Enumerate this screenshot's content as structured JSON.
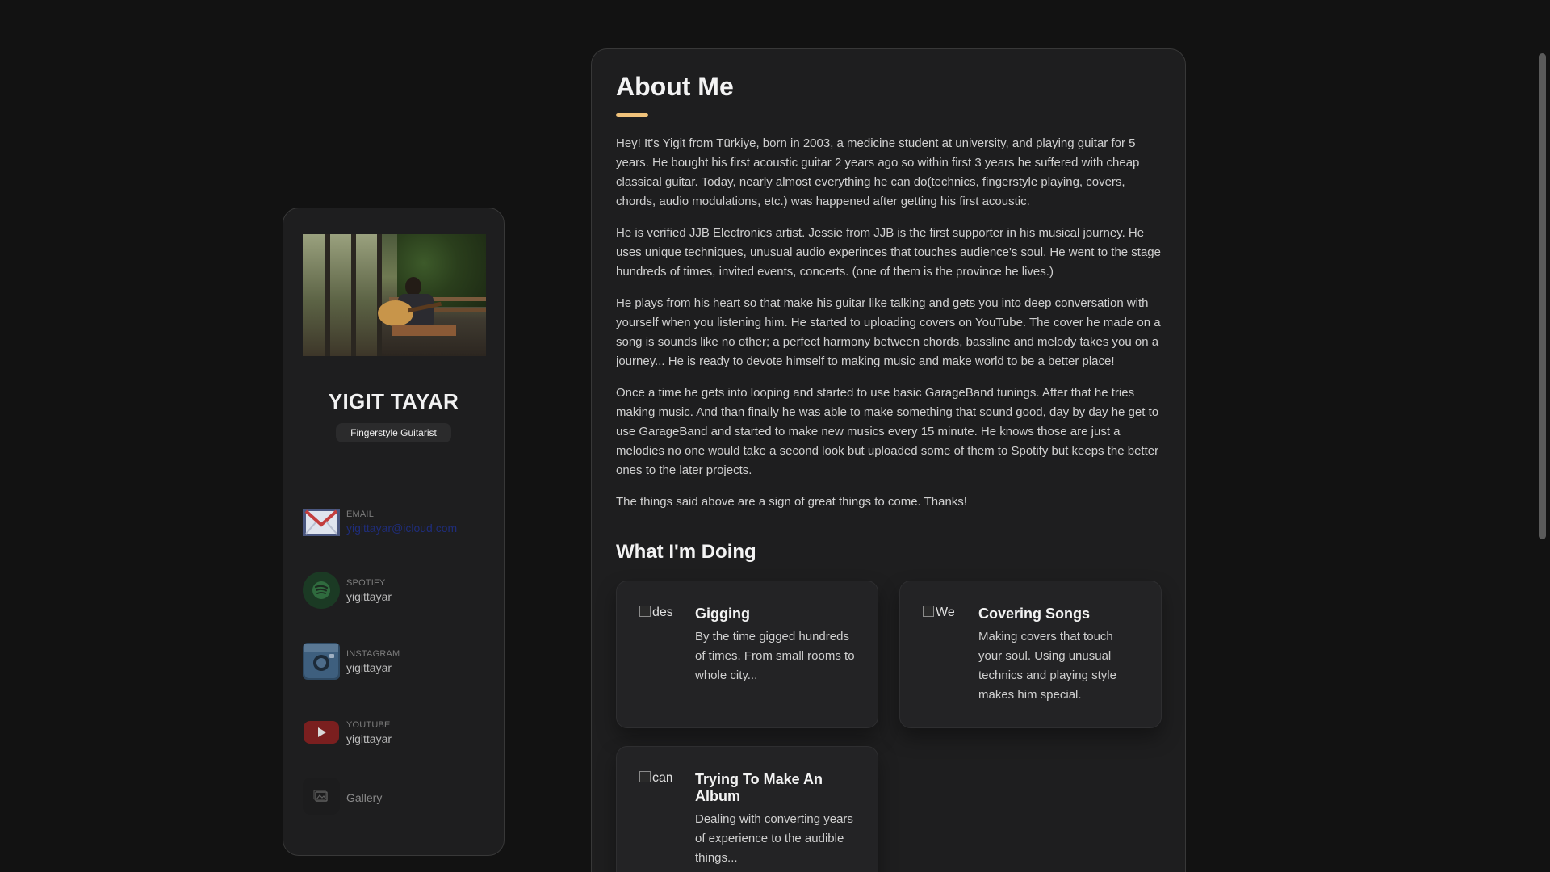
{
  "sidebar": {
    "name": "YIGIT TAYAR",
    "title": "Fingerstyle Guitarist",
    "avatar_alt": "Yigit Tayar",
    "contacts": [
      {
        "label": "EMAIL",
        "value": "yigittayar@icloud.com",
        "icon": "mail-icon"
      },
      {
        "label": "SPOTIFY",
        "value": "yigittayar",
        "icon": "spotify-icon"
      },
      {
        "label": "INSTAGRAM",
        "value": "yigittayar",
        "icon": "instagram-icon"
      },
      {
        "label": "YOUTUBE",
        "value": "yigittayar",
        "icon": "youtube-icon"
      }
    ],
    "gallery": {
      "label": "Gallery",
      "icon": "image-icon"
    }
  },
  "main": {
    "title": "About Me",
    "paragraphs": [
      "Hey! It's Yigit from Türkiye, born in 2003, a medicine student at university, and playing guitar for 5 years. He bought his first acoustic guitar 2 years ago so within first 3 years he suffered with cheap classical guitar. Today, nearly almost everything he can do(technics, fingerstyle playing, covers, chords, audio modulations, etc.) was happened after getting his first acoustic.",
      "He is verified JJB Electronics artist. Jessie from JJB is the first supporter in his musical journey. He uses unique techniques, unusual audio experinces that touches audience's soul. He went to the stage hundreds of times, invited events, concerts. (one of them is the province he lives.)",
      "He plays from his heart so that make his guitar like talking and gets you into deep conversation with yourself when you listening him. He started to uploading covers on YouTube. The cover he made on a song is sounds like no other; a perfect harmony between chords, bassline and melody takes you on a journey... He is ready to devote himself to making music and make world to be a better place!",
      "Once a time he gets into looping and started to use basic GarageBand tunings. After that he tries making music. And than finally he was able to make something that sound good, day by day he get to use GarageBand and started to make new musics every 15 minute. He knows those are just a melodies no one would take a second look but uploaded some of them to Spotify but keeps the better ones to the later projects.",
      "The things said above are a sign of great things to come. Thanks!"
    ],
    "services_title": "What I'm Doing",
    "services": [
      {
        "icon_alt": "design icon",
        "title": "Gigging",
        "text": "By the time gigged hundreds of times. From small rooms to whole city..."
      },
      {
        "icon_alt": "Web development icon",
        "title": "Covering Songs",
        "text": "Making covers that touch your soul. Using unusual technics and playing style makes him special."
      },
      {
        "icon_alt": "camera icon",
        "title": "Trying To Make An Album",
        "text": "Dealing with converting years of experience to the audible things..."
      }
    ]
  },
  "colors": {
    "accent": "#f0c27a",
    "background": "#121212",
    "card": "#1e1e1f",
    "email_link": "#1f2d7a"
  }
}
